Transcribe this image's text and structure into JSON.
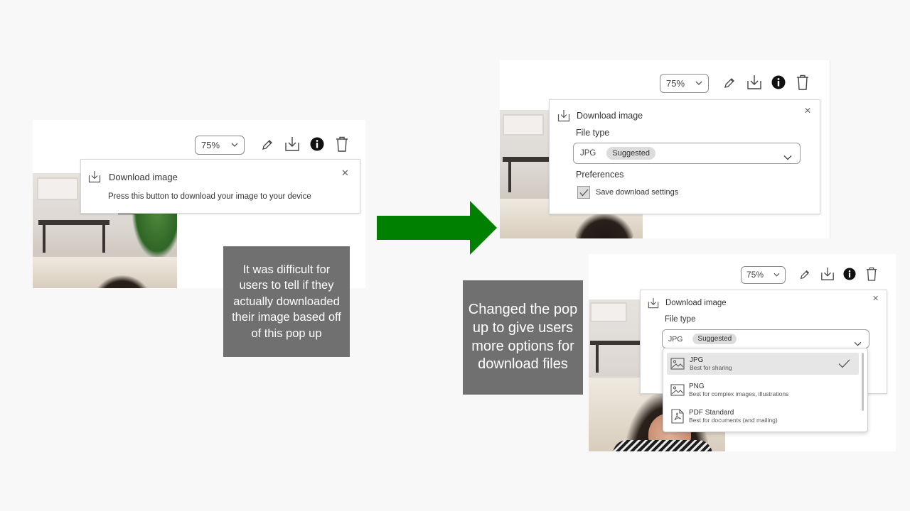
{
  "before": {
    "zoom": "75%",
    "popup_title": "Download image",
    "popup_body": "Press this button to download your image to your device",
    "close_glyph": "✕"
  },
  "before_note": "It was difficult for users to tell if they actually downloaded their image based off of this pop up",
  "arrow_color": "#008000",
  "after_top": {
    "zoom": "75%",
    "popup_title": "Download image",
    "file_type_label": "File type",
    "select_value": "JPG",
    "select_badge": "Suggested",
    "preferences_label": "Preferences",
    "checkbox_label": "Save download settings",
    "checkbox_checked": true,
    "close_glyph": "✕"
  },
  "after_bottom": {
    "zoom": "75%",
    "popup_title": "Download image",
    "file_type_label": "File type",
    "select_value": "JPG",
    "select_badge": "Suggested",
    "close_glyph": "✕",
    "options": [
      {
        "name": "JPG",
        "desc": "Best for sharing",
        "icon": "image-icon",
        "selected": true
      },
      {
        "name": "PNG",
        "desc": "Best for complex images, illustrations",
        "icon": "image-icon",
        "selected": false
      },
      {
        "name": "PDF Standard",
        "desc": "Best for documents (and mailing)",
        "icon": "pdf-icon",
        "selected": false
      }
    ]
  },
  "after_note": "Changed the pop up to give users more options for download files",
  "icons": {
    "zoom_chevron": "chevron-down-icon",
    "edit": "pencil-icon",
    "download": "download-icon",
    "info": "info-icon",
    "delete": "trash-icon",
    "close": "close-icon",
    "check": "check-icon"
  }
}
